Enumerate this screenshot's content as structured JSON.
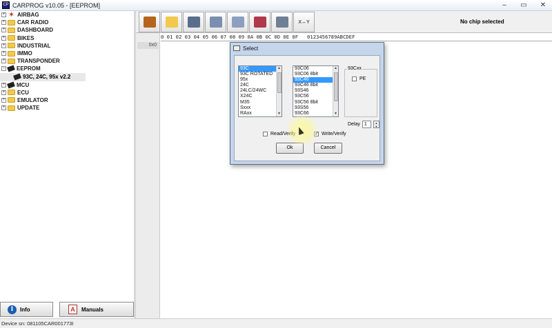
{
  "window": {
    "title": "CARPROG   v10.05 - [EEPROM]",
    "app_icon": "CP",
    "controls": {
      "minimize": "–",
      "maximize": "▭",
      "close": "✕"
    }
  },
  "tree": {
    "items": [
      {
        "label": "AIRBAG",
        "icon": "star-icon",
        "expander": "+"
      },
      {
        "label": "CAR RADIO",
        "icon": "folder-icon",
        "expander": "+"
      },
      {
        "label": "DASHBOARD",
        "icon": "folder-icon",
        "expander": "+"
      },
      {
        "label": "BIKES",
        "icon": "folder-icon",
        "expander": "+"
      },
      {
        "label": "INDUSTRIAL",
        "icon": "folder-icon",
        "expander": "+"
      },
      {
        "label": "IMMO",
        "icon": "folder-icon",
        "expander": "+"
      },
      {
        "label": "TRANSPONDER",
        "icon": "folder-icon",
        "expander": "+"
      },
      {
        "label": "EEPROM",
        "icon": "chip-icon",
        "expander": "–"
      },
      {
        "label": "MCU",
        "icon": "chip-icon",
        "expander": "+"
      },
      {
        "label": "ECU",
        "icon": "folder-icon",
        "expander": "+"
      },
      {
        "label": "EMULATOR",
        "icon": "folder-icon",
        "expander": "+"
      },
      {
        "label": "UPDATE",
        "icon": "folder-icon",
        "expander": "+"
      }
    ],
    "eeprom_child": "93C, 24C, 95x v2.2"
  },
  "buttons": {
    "info": "Info",
    "info_glyph": "i",
    "manuals": "Manuals",
    "pdf_glyph": "A"
  },
  "status": {
    "device_sn": "Device sn: 081105CAR001773I"
  },
  "toolbar": {
    "tools": [
      {
        "name": "tools-icon",
        "color": "#b5651d"
      },
      {
        "name": "open-folder-icon",
        "color": "#f2c94c"
      },
      {
        "name": "save-icon",
        "color": "#5a6e8c"
      },
      {
        "name": "read-chip-icon",
        "color": "#7a8fb0"
      },
      {
        "name": "write-chip-icon",
        "color": "#8c9fbf"
      },
      {
        "name": "erase-chip-icon",
        "color": "#b03a4a"
      },
      {
        "name": "verify-chip-icon",
        "color": "#6f7f95"
      }
    ],
    "swap_label": "X↔Y",
    "chip_status": "No chip selected"
  },
  "hex": {
    "header": "0 01 02 03 04 05 06 07 08 09 0A 0B 0C 0D 0E 0F   0123456789ABCDEF",
    "first_address": "0x0"
  },
  "dialog": {
    "title": "Select",
    "family_list": [
      "93C",
      "93C ROTATED",
      "95x",
      "24C",
      "24LC/24WC",
      "X24C",
      "M35",
      "Sxxx",
      "RAxx"
    ],
    "family_selected": 0,
    "chip_list": [
      "93C06",
      "93C06 8bit",
      "93C46",
      "93C46 8bit",
      "93S46",
      "93C56",
      "93C56 8bit",
      "93S56",
      "93C66"
    ],
    "chip_selected": 2,
    "group_label": "93Cxx",
    "pe_label": "PE",
    "read_verify_label": "Read/Verify",
    "write_verify_label": "Write/Verify",
    "write_verify_checked": "✓",
    "delay_label": "Delay",
    "delay_value": "1",
    "ok_label": "Ok",
    "cancel_label": "Cancel"
  }
}
